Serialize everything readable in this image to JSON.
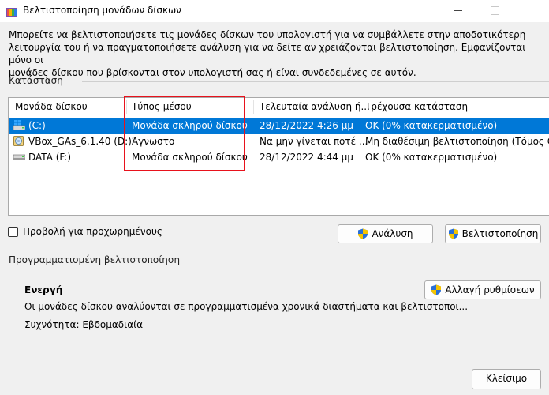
{
  "window": {
    "title": "Βελτιστοποίηση μονάδων δίσκων",
    "icon": "defrag-app-icon"
  },
  "description": "Μπορείτε να βελτιστοποιήσετε τις μονάδες δίσκων του υπολογιστή για να συμβάλλετε στην αποδοτικότερη\nλειτουργία του ή να πραγματοποιήσετε ανάλυση για να δείτε αν χρειάζονται βελτιστοποίηση. Εμφανίζονται μόνο οι\nμονάδες δίσκου που βρίσκονται στον υπολογιστή σας ή είναι συνδεδεμένες σε αυτόν.",
  "status_section": {
    "label": "Κατάσταση",
    "columns": [
      "Μονάδα δίσκου",
      "Τύπος μέσου",
      "Τελευταία ανάλυση ή...",
      "Τρέχουσα κατάσταση"
    ],
    "rows": [
      {
        "drive": "(C:)",
        "media": "Μονάδα σκληρού δίσκου",
        "last": "28/12/2022 4:26 μμ",
        "status": "OK (0% κατακερματισμένο)",
        "icon": "windows-drive-icon"
      },
      {
        "drive": "VBox_GAs_6.1.40 (D:)",
        "media": "Άγνωστο",
        "last": "Να μην γίνεται ποτέ ...",
        "status": "Μη διαθέσιμη βελτιστοποίηση (Τόμος CD-R",
        "icon": "cd-drive-icon"
      },
      {
        "drive": "DATA (F:)",
        "media": "Μονάδα σκληρού δίσκου",
        "last": "28/12/2022 4:44 μμ",
        "status": "OK (0% κατακερματισμένο)",
        "icon": "hard-drive-icon"
      }
    ],
    "selected_row": 0
  },
  "advanced_view_label": "Προβολή για προχωρημένους",
  "analyze_label": "Ανάλυση",
  "optimize_label": "Βελτιστοποίηση",
  "scheduled": {
    "label": "Προγραμματισμένη βελτιστοποίηση",
    "state": "Ενεργή",
    "description": "Οι μονάδες δίσκου αναλύονται σε προγραμματισμένα χρονικά διαστήματα και βελτιστοποι...",
    "frequency": "Συχνότητα: Εβδομαδιαία",
    "change_settings_label": "Αλλαγή ρυθμίσεων"
  },
  "close_label": "Κλείσιμο",
  "colors": {
    "selection": "#0078d7",
    "highlight_box": "#e8121c",
    "shield_blue": "#2a6fd6",
    "shield_yellow": "#f5c400"
  }
}
